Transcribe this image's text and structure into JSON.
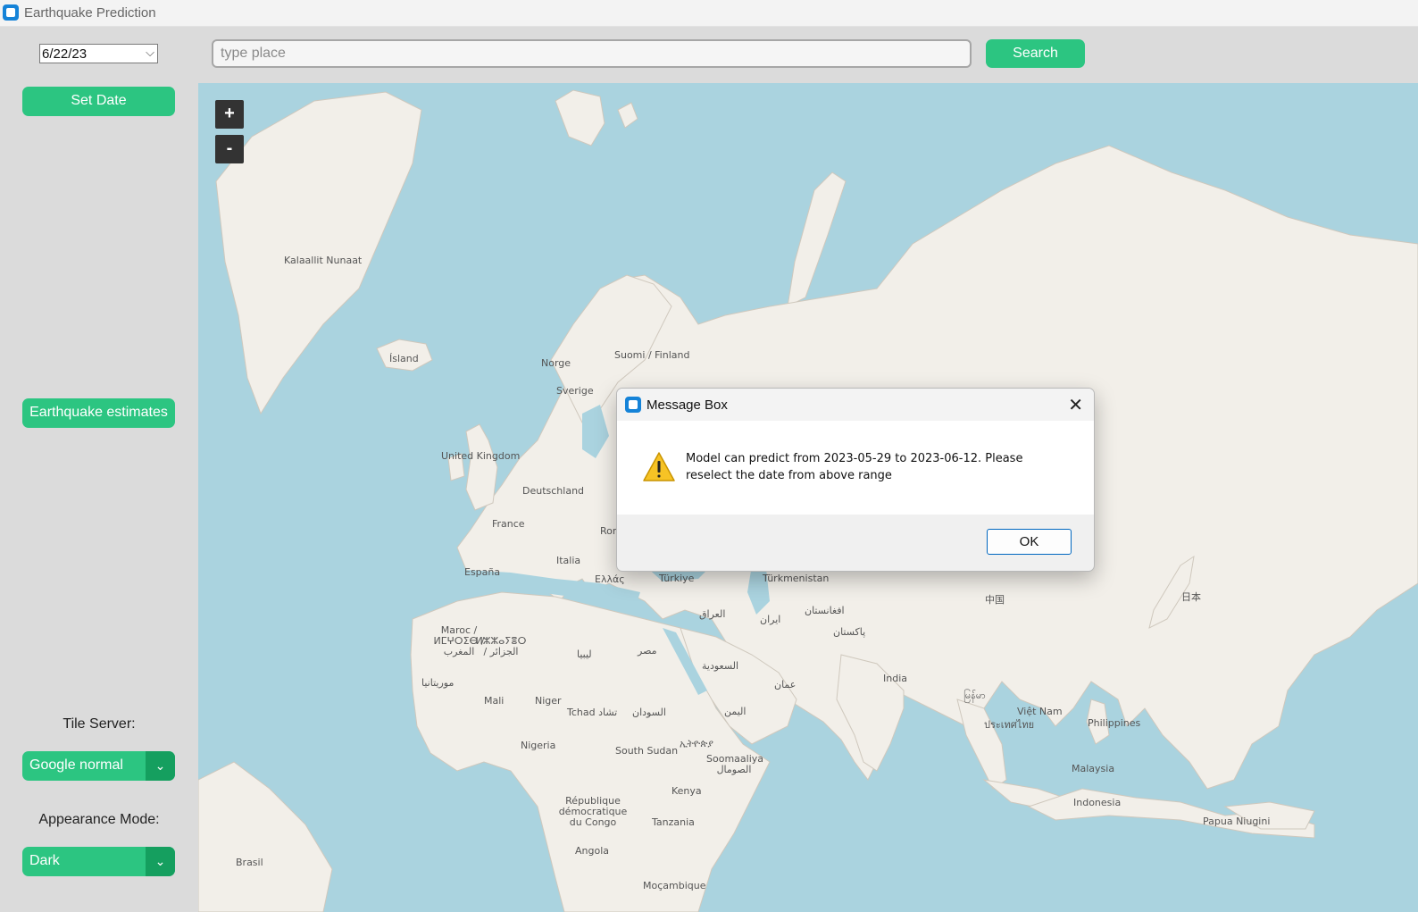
{
  "window": {
    "title": "Earthquake Prediction",
    "icon": "app-icon"
  },
  "sidebar": {
    "date_value": "6/22/23",
    "set_date_label": "Set Date",
    "estimates_label": "Earthquake estimates",
    "tile_server_label": "Tile Server:",
    "tile_server_value": "Google normal",
    "appearance_label": "Appearance Mode:",
    "appearance_value": "Dark"
  },
  "search": {
    "placeholder": "type place",
    "button_label": "Search"
  },
  "map": {
    "zoom_in": "+",
    "zoom_out": "-",
    "labels": [
      "Kalaallit Nunaat",
      "Ísland",
      "Norge",
      "Suomi / Finland",
      "Sverige",
      "United Kingdom",
      "Deutschland",
      "France",
      "España",
      "Italia",
      "Rom",
      "Ελλάς",
      "Türkiye",
      "Türkmenistan",
      "中国",
      "日本",
      "العراق",
      "ایران",
      "افغانستان",
      "پاکستان",
      "Maroc / ⵍⵎⵖⵔⵉⴱ / المغرب",
      "ⵍⵣⵣⴰⵢⴻⵔ / الجزائر",
      "ليبيا",
      "مصر",
      "السعودية",
      "عمان",
      "India",
      "မြန်မာ",
      "Việt Nam",
      "Philippines",
      "ประเทศไทย",
      "Malaysia",
      "Indonesia",
      "Papua Niugini",
      "موريتانيا",
      "Mali",
      "Niger",
      "Tchad تشاد",
      "السودان",
      "اليمن",
      "Nigeria",
      "South Sudan",
      "ኢትዮጵያ",
      "Soomaaliya الصومال",
      "République démocratique du Congo",
      "Kenya",
      "Tanzania",
      "Angola",
      "Moçambique",
      "Brasil"
    ]
  },
  "dialog": {
    "title": "Message Box",
    "message": "Model can predict from 2023-05-29 to 2023-06-12. Please reselect the date from above range",
    "ok_label": "OK",
    "close_glyph": "✕"
  },
  "colors": {
    "accent": "#2cc581",
    "accent_dark": "#159f5f",
    "water": "#aad3df",
    "land": "#f2efe9",
    "sidebar_bg": "#dbdbdb"
  }
}
